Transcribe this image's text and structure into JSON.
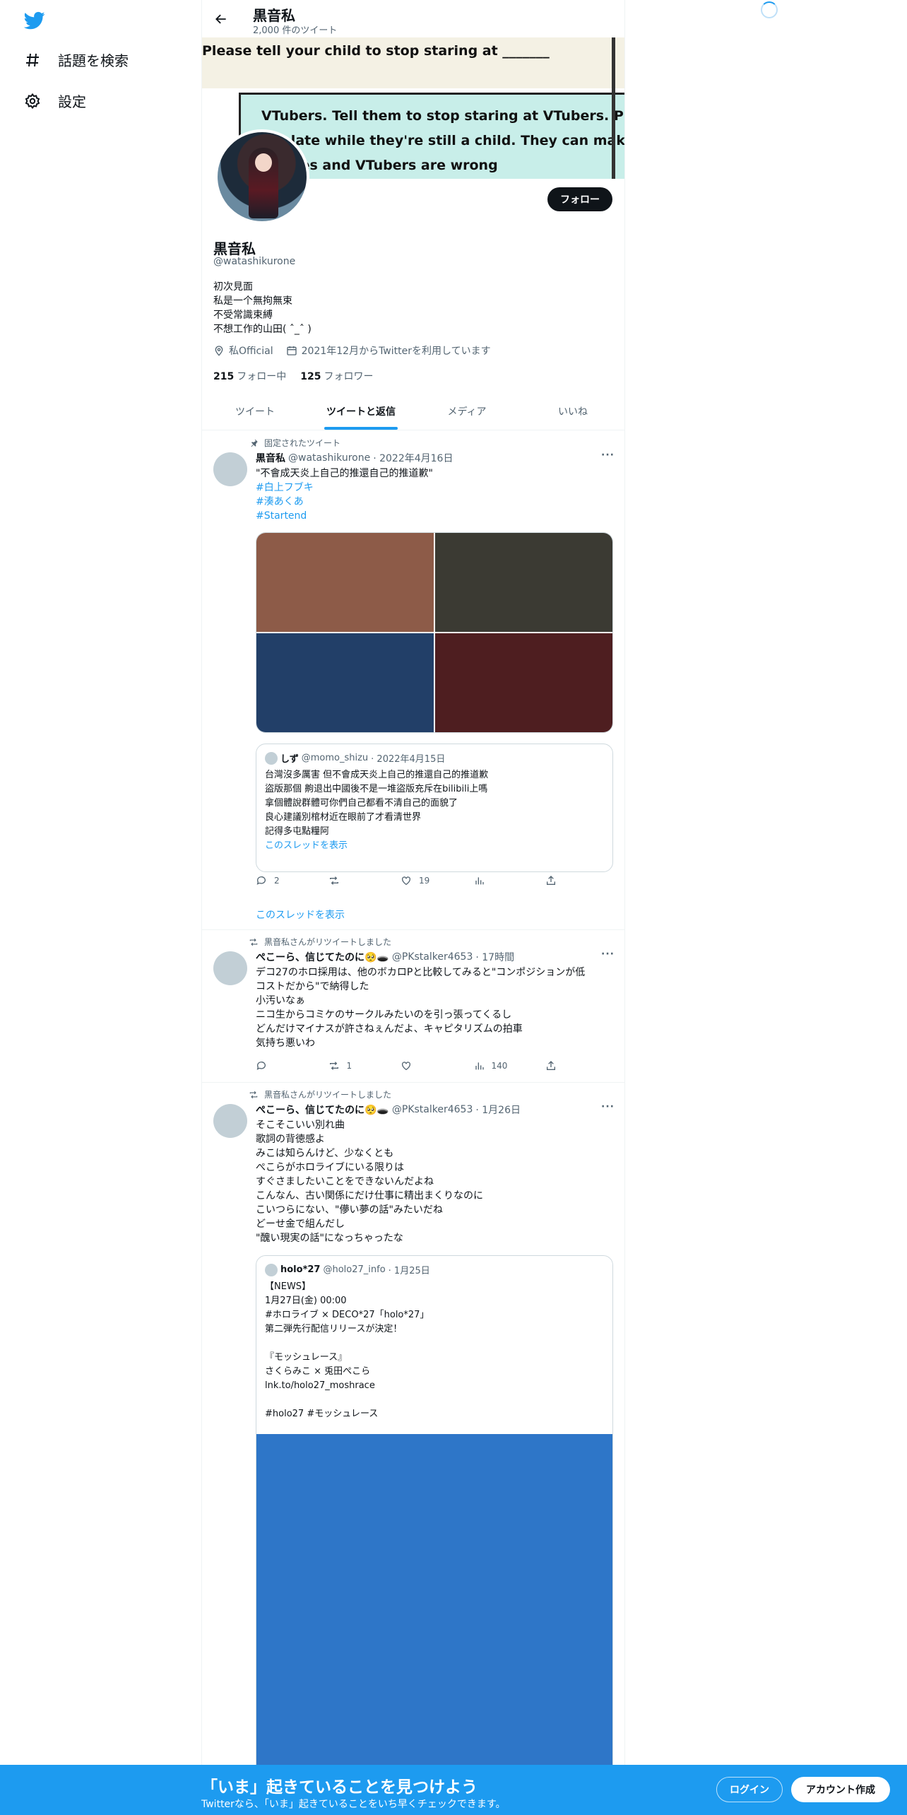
{
  "sidebar": {
    "items": [
      {
        "label": "話題を検索",
        "icon": "hashtag-icon"
      },
      {
        "label": "設定",
        "icon": "gear-icon"
      }
    ]
  },
  "header": {
    "title": "黒音私",
    "subtitle": "2,000 件のツイート"
  },
  "banner": {
    "line1": "Please tell your child to stop staring at _______",
    "line2": "VTubers. Tell them to stop staring at VTubers. Please, it",
    "line3": "too late while they're still a child. They can make",
    "line4": "choices and VTubers are wrong"
  },
  "profile": {
    "name": "黒音私",
    "handle": "@watashikurone",
    "follow_label": "フォロー",
    "bio": [
      "初次見面",
      "私是一个無拘無束",
      "不受常識束縛",
      "不想工作的山田( ˆ_ˆ )"
    ],
    "location": "私Official",
    "joined": "2021年12月からTwitterを利用しています",
    "following_count": "215",
    "following_label": "フォロー中",
    "followers_count": "125",
    "followers_label": "フォロワー"
  },
  "tabs": [
    {
      "label": "ツイート",
      "active": false
    },
    {
      "label": "ツイートと返信",
      "active": true
    },
    {
      "label": "メディア",
      "active": false
    },
    {
      "label": "いいね",
      "active": false
    }
  ],
  "tweets": [
    {
      "context": "固定されたツイート",
      "name": "黒音私",
      "handle": "@watashikurone",
      "date": "· 2022年4月16日",
      "body": [
        "\"不會成天炎上自己的推還自己的推道歉\""
      ],
      "tags": [
        "#白上フブキ",
        "#湊あくあ",
        "#Startend"
      ],
      "media_colors": [
        "#8d5b48",
        "#3b3a33",
        "#223f68",
        "#4e1e20"
      ],
      "quote": {
        "name": "しず",
        "handle": "@momo_shizu",
        "date": "· 2022年4月15日",
        "body": [
          "台灣沒多厲害 但不會成天炎上自己的推還自己的推道歉",
          "盜版那個 齁退出中國後不是一堆盜版充斥在bilibili上嗎",
          "拿個體說群體可你們自己都看不清自己的面貌了",
          "良心建議別棺材近在眼前了才看清世界",
          "記得多屯點糧阿"
        ],
        "link": "このスレッドを表示"
      },
      "replies": "2",
      "retweets": "",
      "likes": "19",
      "views": "",
      "thread_link": "このスレッドを表示"
    },
    {
      "context": "黒音私さんがリツイートしました",
      "name": "ぺこーら、信じてたのに🥺🕳️",
      "handle": "@PKstalker4653",
      "date": "· 17時間",
      "body": [
        "デコ27のホロ採用は、他のボカロPと比較してみると\"コンポジションが低",
        "コストだから\"で納得した",
        "小汚いなぁ",
        "ニコ生からコミケのサークルみたいのを引っ張ってくるし",
        "どんだけマイナスが許さねぇんだよ、キャピタリズムの拍車",
        "気持ち悪いわ"
      ],
      "replies": "",
      "retweets": "1",
      "likes": "",
      "views": "140"
    },
    {
      "context": "黒音私さんがリツイートしました",
      "name": "ぺこーら、信じてたのに🥺🕳️",
      "handle": "@PKstalker4653",
      "date": "· 1月26日",
      "body": [
        "そこそこいい別れ曲",
        "歌詞の背徳感よ",
        "みこは知らんけど、少なくとも",
        "ぺこらがホロライブにいる限りは",
        "すぐさましたいことをできないんだよね",
        "こんなん、古い関係にだけ仕事に精出まくりなのに",
        "こいつらにない、\"儚い夢の話\"みたいだね",
        "どーせ金で組んだし",
        "\"醜い現実の話\"になっちゃったな"
      ],
      "quote": {
        "name": "holo*27",
        "handle": "@holo27_info",
        "date": "· 1月25日",
        "body": [
          "【NEWS】",
          "1月27日(金) 00:00",
          "#ホロライブ × DECO*27「holo*27」",
          "第二弾先行配信リリースが決定！",
          "",
          "『モッシュレース』",
          "さくらみこ × 兎田ぺこら",
          "lnk.to/holo27_moshrace",
          "",
          "#holo27 #モッシュレース"
        ],
        "media_color": "#2e76c8"
      }
    }
  ],
  "bottom_bar": {
    "title": "「いま」起きていることを見つけよう",
    "subtitle": "Twitterなら、「いま」起きていることをいち早くチェックできます。",
    "login_label": "ログイン",
    "signup_label": "アカウント作成"
  }
}
